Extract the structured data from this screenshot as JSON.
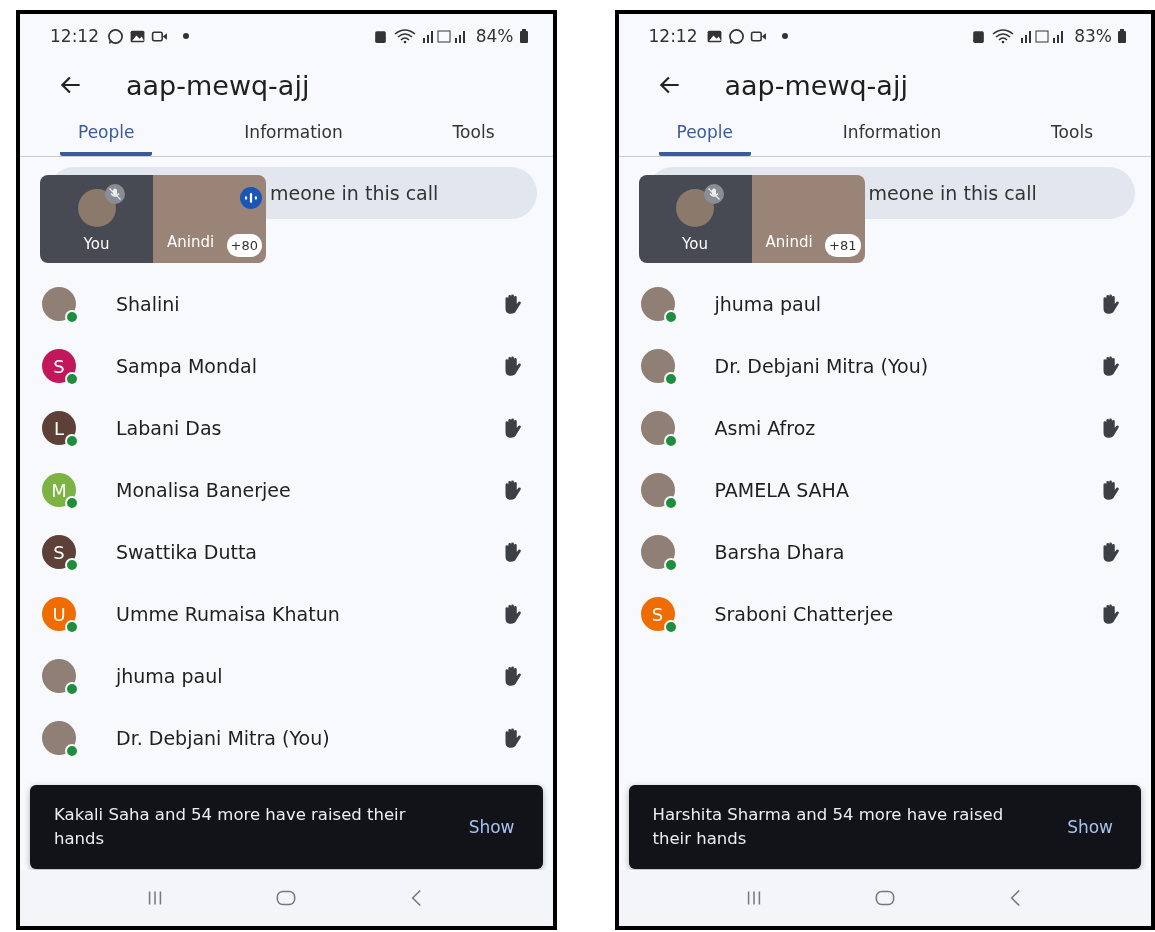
{
  "phones": [
    {
      "status_bar": {
        "time": "12:12",
        "notification_icons": [
          {
            "kind": "chat"
          },
          {
            "kind": "gallery"
          },
          {
            "kind": "video"
          }
        ],
        "battery": "84%"
      },
      "title": "aap-mewq-ajj",
      "tabs": [
        {
          "label": "People",
          "selected": true
        },
        {
          "label": "Information",
          "selected": false
        },
        {
          "label": "Tools",
          "selected": false
        }
      ],
      "pill_text": "meone in this call",
      "tiles": [
        {
          "kind": "self",
          "label": "You",
          "muted": true
        },
        {
          "kind": "video",
          "label": "Anindi",
          "speaking": true
        }
      ],
      "overflow_count": "+80",
      "participants": [
        {
          "name": "Shalini",
          "avatar": {
            "kind": "photo"
          }
        },
        {
          "name": "Sampa Mondal",
          "avatar": {
            "kind": "letter",
            "letter": "S",
            "color": "#c2185b"
          }
        },
        {
          "name": "Labani Das",
          "avatar": {
            "kind": "letter",
            "letter": "L",
            "color": "#5d4037"
          }
        },
        {
          "name": "Monalisa Banerjee",
          "avatar": {
            "kind": "letter",
            "letter": "M",
            "color": "#7cb342"
          }
        },
        {
          "name": "Swattika Dutta",
          "avatar": {
            "kind": "letter",
            "letter": "S",
            "color": "#5d4037"
          }
        },
        {
          "name": "Umme Rumaisa Khatun",
          "avatar": {
            "kind": "letter",
            "letter": "U",
            "color": "#ef6c00"
          }
        },
        {
          "name": "jhuma paul",
          "avatar": {
            "kind": "photo"
          }
        },
        {
          "name": "Dr. Debjani Mitra (You)",
          "avatar": {
            "kind": "photo"
          }
        }
      ],
      "snackbar": {
        "message": "Kakali Saha and 54 more have raised their hands",
        "action": "Show"
      }
    },
    {
      "status_bar": {
        "time": "12:12",
        "notification_icons": [
          {
            "kind": "gallery"
          },
          {
            "kind": "chat"
          },
          {
            "kind": "video"
          }
        ],
        "battery": "83%"
      },
      "title": "aap-mewq-ajj",
      "tabs": [
        {
          "label": "People",
          "selected": true
        },
        {
          "label": "Information",
          "selected": false
        },
        {
          "label": "Tools",
          "selected": false
        }
      ],
      "pill_text": "meone in this call",
      "tiles": [
        {
          "kind": "self",
          "label": "You",
          "muted": true
        },
        {
          "kind": "video",
          "label": "Anindi",
          "speaking": false
        }
      ],
      "overflow_count": "+81",
      "participants": [
        {
          "name": "jhuma paul",
          "avatar": {
            "kind": "photo"
          }
        },
        {
          "name": "Dr. Debjani Mitra (You)",
          "avatar": {
            "kind": "photo"
          }
        },
        {
          "name": "Asmi Afroz",
          "avatar": {
            "kind": "photo"
          }
        },
        {
          "name": "PAMELA SAHA",
          "avatar": {
            "kind": "photo"
          }
        },
        {
          "name": "Barsha Dhara",
          "avatar": {
            "kind": "photo"
          }
        },
        {
          "name": "Sraboni Chatterjee",
          "avatar": {
            "kind": "letter",
            "letter": "S",
            "color": "#ef6c00"
          }
        }
      ],
      "snackbar": {
        "message": "Harshita Sharma and 54 more have raised their hands",
        "action": "Show"
      }
    }
  ]
}
